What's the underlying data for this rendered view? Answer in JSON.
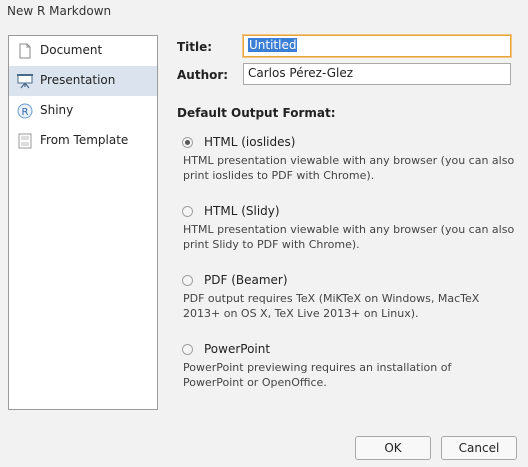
{
  "window": {
    "title": "New R Markdown"
  },
  "sidebar": {
    "items": [
      {
        "label": "Document",
        "icon": "document-icon",
        "selected": false
      },
      {
        "label": "Presentation",
        "icon": "presentation-icon",
        "selected": true
      },
      {
        "label": "Shiny",
        "icon": "shiny-icon",
        "selected": false
      },
      {
        "label": "From Template",
        "icon": "template-icon",
        "selected": false
      }
    ]
  },
  "form": {
    "title_label": "Title:",
    "title_value": "Untitled",
    "author_label": "Author:",
    "author_value": "Carlos Pérez-Glez"
  },
  "output_format": {
    "heading": "Default Output Format:",
    "options": [
      {
        "label": "HTML (ioslides)",
        "checked": true,
        "desc_line1": "HTML presentation viewable with any browser (you can also",
        "desc_line2": "print ioslides to PDF with Chrome)."
      },
      {
        "label": "HTML (Slidy)",
        "checked": false,
        "desc_line1": "HTML presentation viewable with any browser (you can also",
        "desc_line2": "print Slidy to PDF with Chrome)."
      },
      {
        "label": "PDF (Beamer)",
        "checked": false,
        "desc_line1": "PDF output requires TeX (MiKTeX on Windows, MacTeX",
        "desc_line2": "2013+ on OS X, TeX Live 2013+ on Linux)."
      },
      {
        "label": "PowerPoint",
        "checked": false,
        "desc_line1": "PowerPoint previewing requires an installation of",
        "desc_line2": "PowerPoint or OpenOffice."
      }
    ]
  },
  "buttons": {
    "ok": "OK",
    "cancel": "Cancel"
  },
  "colors": {
    "selection_bg": "#dbe4ee",
    "focus_border": "#e8a43c",
    "text_selection": "#3b7ed6"
  }
}
